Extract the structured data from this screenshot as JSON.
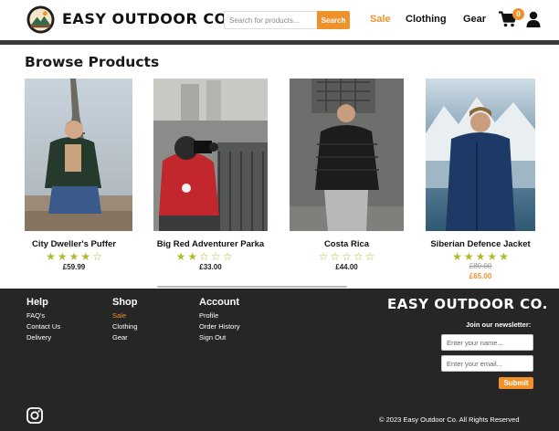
{
  "header": {
    "brand": "EASY OUTDOOR CO.",
    "search_placeholder": "Search for products...",
    "search_button": "Search",
    "nav": [
      {
        "label": "Sale"
      },
      {
        "label": "Clothing"
      },
      {
        "label": "Gear"
      }
    ],
    "cart_count": "0"
  },
  "main": {
    "title": "Browse Products",
    "products": [
      {
        "name": "City Dweller's Puffer",
        "rating": 4,
        "price": "£59.99"
      },
      {
        "name": "Big Red Adventurer Parka",
        "rating": 2,
        "price": "£33.00"
      },
      {
        "name": "Costa Rica",
        "rating": 0,
        "price": "£44.00"
      },
      {
        "name": "Siberian Defence Jacket",
        "rating": 5,
        "price_old": "£80.00",
        "price": "£65.00"
      }
    ]
  },
  "footer": {
    "help": {
      "title": "Help",
      "links": [
        "FAQ's",
        "Contact Us",
        "Delivery"
      ]
    },
    "shop": {
      "title": "Shop",
      "links": [
        "Sale",
        "Clothing",
        "Gear"
      ]
    },
    "account": {
      "title": "Account",
      "links": [
        "Profile",
        "Order History",
        "Sign Out"
      ]
    },
    "brand": "EASY OUTDOOR CO.",
    "newsletter_title": "Join our newsletter:",
    "name_placeholder": "Enter your name...",
    "email_placeholder": "Enter your email...",
    "submit": "Submit",
    "copyright": "© 2023 Easy Outdoor Co. All Rights Reserved"
  },
  "colors": {
    "accent": "#f0922b",
    "footer_bg": "#262626",
    "star": "#b2b92c"
  },
  "icons": [
    "logo-badge",
    "cart-icon",
    "user-icon",
    "instagram-icon",
    "star-icon"
  ]
}
